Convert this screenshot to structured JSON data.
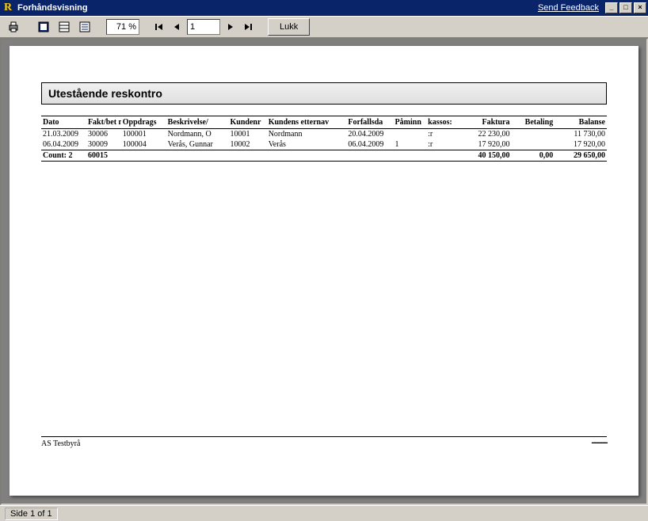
{
  "window": {
    "app_letter": "R",
    "title": "Forhåndsvisning",
    "feedback_label": "Send Feedback"
  },
  "toolbar": {
    "zoom_value": "71 %",
    "page_value": "1",
    "close_label": "Lukk"
  },
  "report": {
    "title": "Utestående reskontro",
    "columns": {
      "dato": "Dato",
      "fakt": "Fakt/bet nr.",
      "oppdrag": "Oppdrags",
      "beskriv": "Beskrivelse/",
      "kundenr": "Kundenr",
      "etternavn": "Kundens etternav",
      "forfall": "Forfallsda",
      "paminn": "Påminn",
      "kasso": "kassos:",
      "faktura": "Faktura",
      "betaling": "Betaling",
      "balanse": "Balanse"
    },
    "rows": [
      {
        "dato": "21.03.2009",
        "fakt": "30006",
        "oppdrag": "100001",
        "beskriv": "Nordmann, O",
        "kundenr": "10001",
        "etternavn": "Nordmann",
        "forfall": "20.04.2009",
        "paminn": "",
        "kasso": ":r",
        "faktura": "22 230,00",
        "betaling": "",
        "balanse": "11 730,00"
      },
      {
        "dato": "06.04.2009",
        "fakt": "30009",
        "oppdrag": "100004",
        "beskriv": "Verås, Gunnar",
        "kundenr": "10002",
        "etternavn": "Verås",
        "forfall": "06.04.2009",
        "paminn": "1",
        "kasso": ":r",
        "faktura": "17 920,00",
        "betaling": "",
        "balanse": "17 920,00"
      }
    ],
    "totals": {
      "count_label": "Count: 2",
      "fakt_sum": "60015",
      "faktura_sum": "40 150,00",
      "betaling_sum": "0,00",
      "balanse_sum": "29 650,00"
    },
    "footer_left": "AS Testbyrå"
  },
  "status": {
    "text": "Side 1 of 1"
  },
  "chart_data": {
    "type": "table",
    "title": "Utestående reskontro",
    "columns": [
      "Dato",
      "Fakt/bet nr.",
      "Oppdragsnr",
      "Beskrivelse",
      "Kundenr",
      "Kundens etternavn",
      "Forfallsdato",
      "Påminn",
      "Inkasso",
      "Faktura",
      "Betaling",
      "Balanse"
    ],
    "rows": [
      [
        "21.03.2009",
        "30006",
        "100001",
        "Nordmann, O",
        "10001",
        "Nordmann",
        "20.04.2009",
        "",
        "",
        "22230.00",
        "",
        "11730.00"
      ],
      [
        "06.04.2009",
        "30009",
        "100004",
        "Verås, Gunnar",
        "10002",
        "Verås",
        "06.04.2009",
        "1",
        "",
        "17920.00",
        "",
        "17920.00"
      ]
    ],
    "totals": {
      "count": 2,
      "fakt_sum": 60015,
      "faktura": 40150.0,
      "betaling": 0.0,
      "balanse": 29650.0
    }
  }
}
